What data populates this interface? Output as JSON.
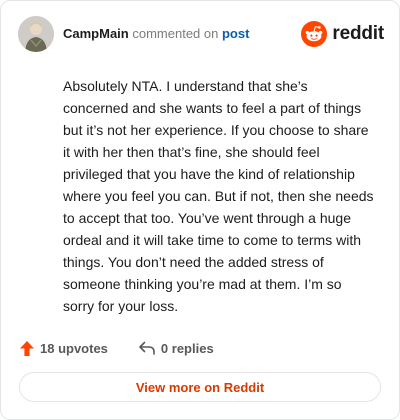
{
  "header": {
    "username": "CampMain",
    "action_text": "commented on",
    "post_link": "post",
    "brand_word": "reddit"
  },
  "comment": {
    "text": "Absolutely NTA. I understand that she’s concerned and she wants to feel a part of things but it’s not her experience. If you choose to share it with her then that’s fine, she should feel privileged that you have the kind of relationship where you feel you can. But if not, then she needs to accept that too. You’ve went through a huge ordeal and it will take time to come to terms with things. You don’t need the added stress of someone thinking you’re mad at them. I’m so sorry for your loss."
  },
  "footer": {
    "upvotes_label": "18 upvotes",
    "replies_label": "0 replies",
    "view_more_label": "View more on Reddit"
  },
  "icons": {
    "upvote": "upvote-arrow-icon",
    "reply": "reply-arrow-icon",
    "brand": "reddit-snoo-logo"
  },
  "colors": {
    "accent": "#ff4500",
    "link": "#0a5fa8",
    "view_more": "#d93a00",
    "text": "#1c1c1c",
    "muted": "#7c7c7c"
  }
}
